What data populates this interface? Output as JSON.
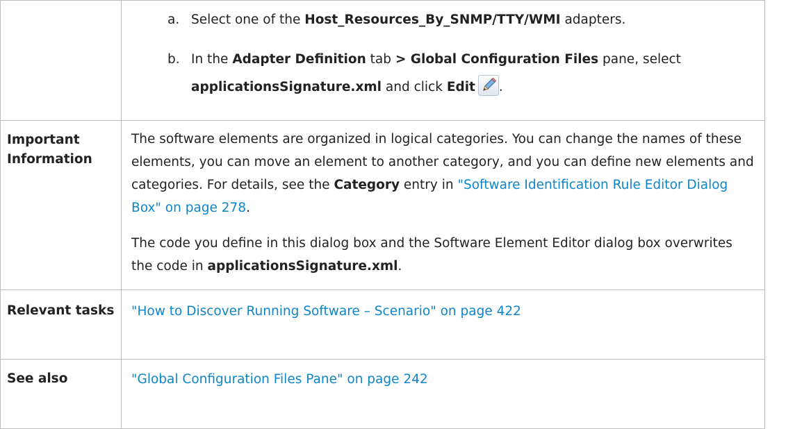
{
  "steps": {
    "a": {
      "marker": "a.",
      "t1": "Select one of the ",
      "b1": "Host_Resources_By_SNMP/TTY/WMI",
      "t2": " adapters."
    },
    "b": {
      "marker": "b.",
      "t1": "In the ",
      "b1": "Adapter Definition",
      "t2": " tab ",
      "b2": "> Global Configuration Files",
      "t3": " pane, select",
      "b3": "applicationsSignature.xml",
      "t4": " and click ",
      "b4": "Edit",
      "t5": "."
    },
    "icon": "pencil-edit-icon"
  },
  "rows": {
    "important": {
      "label": "Important Information",
      "p1": {
        "t1": "The software elements are organized in logical categories. You can change the names of these elements, you can move an element to another category, and you can define new elements and categories. For details, see the ",
        "b1": "Category",
        "t2": " entry in ",
        "link": "\"Software Identification Rule Editor Dialog Box\" on page 278",
        "t3": "."
      },
      "p2": {
        "t1": "The code you define in this dialog box and the Software Element Editor dialog box overwrites the code in ",
        "b1": "applicationsSignature.xml",
        "t2": "."
      }
    },
    "tasks": {
      "label": "Relevant tasks",
      "link": "\"How to Discover Running Software – Scenario\" on page 422"
    },
    "see_also": {
      "label": "See also",
      "link": "\"Global Configuration Files Pane\" on page 242"
    }
  },
  "colors": {
    "link": "#0e85c8",
    "border": "#bdbdbd",
    "text": "#222222"
  }
}
